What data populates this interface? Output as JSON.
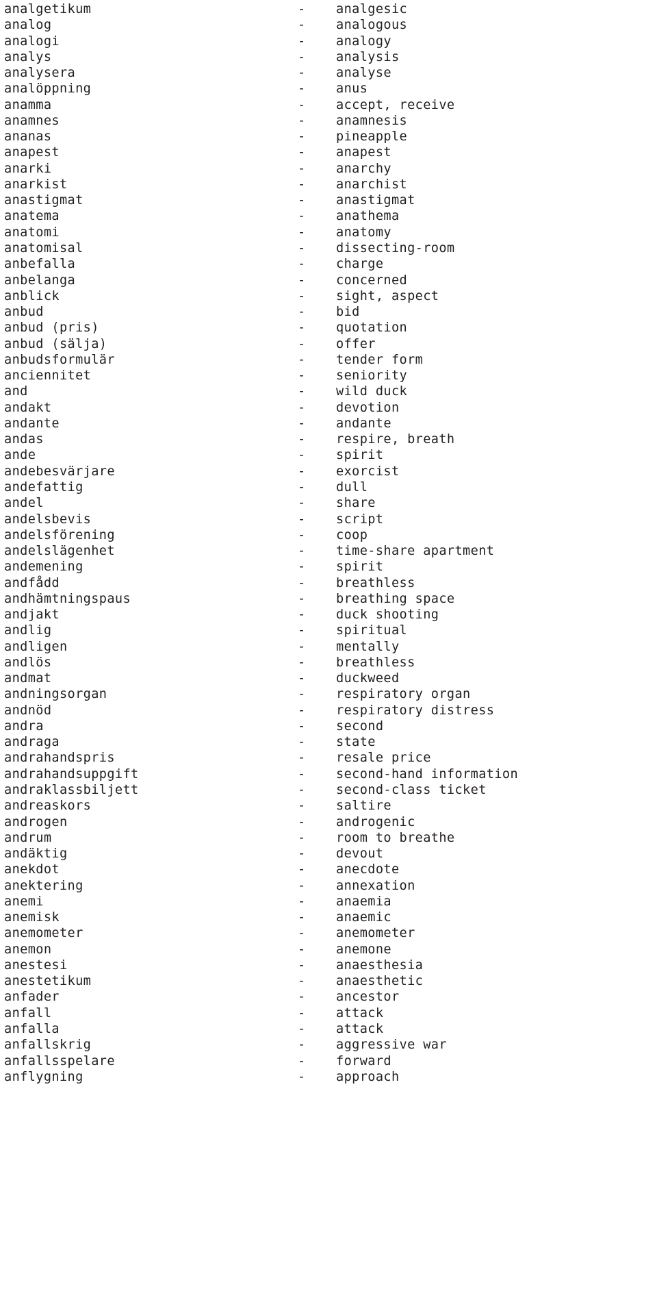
{
  "page": {
    "kind": "bilingual-dictionary-wordlist",
    "source_language": "Swedish",
    "target_language": "English",
    "separator": "-",
    "text_color": "#231f20",
    "background_color": "#ffffff"
  },
  "entries": [
    {
      "swedish": "analgetikum",
      "dash": "-",
      "english": "analgesic"
    },
    {
      "swedish": "analog",
      "dash": "-",
      "english": "analogous"
    },
    {
      "swedish": "analogi",
      "dash": "-",
      "english": "analogy"
    },
    {
      "swedish": "analys",
      "dash": "-",
      "english": "analysis"
    },
    {
      "swedish": "analysera",
      "dash": "-",
      "english": "analyse"
    },
    {
      "swedish": "analöppning",
      "dash": "-",
      "english": "anus"
    },
    {
      "swedish": "anamma",
      "dash": "-",
      "english": "accept, receive"
    },
    {
      "swedish": "anamnes",
      "dash": "-",
      "english": "anamnesis"
    },
    {
      "swedish": "ananas",
      "dash": "-",
      "english": "pineapple"
    },
    {
      "swedish": "anapest",
      "dash": "-",
      "english": "anapest"
    },
    {
      "swedish": "anarki",
      "dash": "-",
      "english": "anarchy"
    },
    {
      "swedish": "anarkist",
      "dash": "-",
      "english": "anarchist"
    },
    {
      "swedish": "anastigmat",
      "dash": "-",
      "english": "anastigmat"
    },
    {
      "swedish": "anatema",
      "dash": "-",
      "english": "anathema"
    },
    {
      "swedish": "anatomi",
      "dash": "-",
      "english": "anatomy"
    },
    {
      "swedish": "anatomisal",
      "dash": "-",
      "english": "dissecting-room"
    },
    {
      "swedish": "anbefalla",
      "dash": "-",
      "english": "charge"
    },
    {
      "swedish": "anbelanga",
      "dash": "-",
      "english": "concerned"
    },
    {
      "swedish": "anblick",
      "dash": "-",
      "english": "sight, aspect"
    },
    {
      "swedish": "anbud",
      "dash": "-",
      "english": "bid"
    },
    {
      "swedish": "anbud (pris)",
      "dash": "-",
      "english": "quotation"
    },
    {
      "swedish": "anbud (sälja)",
      "dash": "-",
      "english": "offer"
    },
    {
      "swedish": "anbudsformulär",
      "dash": "-",
      "english": "tender form"
    },
    {
      "swedish": "anciennitet",
      "dash": "-",
      "english": "seniority"
    },
    {
      "swedish": "and",
      "dash": "-",
      "english": "wild duck"
    },
    {
      "swedish": "andakt",
      "dash": "-",
      "english": "devotion"
    },
    {
      "swedish": "andante",
      "dash": "-",
      "english": "andante"
    },
    {
      "swedish": "andas",
      "dash": "-",
      "english": "respire, breath"
    },
    {
      "swedish": "ande",
      "dash": "-",
      "english": "spirit"
    },
    {
      "swedish": "andebesvärjare",
      "dash": "-",
      "english": "exorcist"
    },
    {
      "swedish": "andefattig",
      "dash": "-",
      "english": "dull"
    },
    {
      "swedish": "andel",
      "dash": "-",
      "english": "share"
    },
    {
      "swedish": "andelsbevis",
      "dash": "-",
      "english": "script"
    },
    {
      "swedish": "andelsförening",
      "dash": "-",
      "english": "coop"
    },
    {
      "swedish": "andelslägenhet",
      "dash": "-",
      "english": "time-share apartment"
    },
    {
      "swedish": "andemening",
      "dash": "-",
      "english": "spirit"
    },
    {
      "swedish": "andfådd",
      "dash": "-",
      "english": "breathless"
    },
    {
      "swedish": "andhämtningspaus",
      "dash": "-",
      "english": "breathing space"
    },
    {
      "swedish": "andjakt",
      "dash": "-",
      "english": "duck shooting"
    },
    {
      "swedish": "andlig",
      "dash": "-",
      "english": "spiritual"
    },
    {
      "swedish": "andligen",
      "dash": "-",
      "english": "mentally"
    },
    {
      "swedish": "andlös",
      "dash": "-",
      "english": "breathless"
    },
    {
      "swedish": "andmat",
      "dash": "-",
      "english": "duckweed"
    },
    {
      "swedish": "andningsorgan",
      "dash": "-",
      "english": "respiratory organ"
    },
    {
      "swedish": "andnöd",
      "dash": "-",
      "english": "respiratory distress"
    },
    {
      "swedish": "andra",
      "dash": "-",
      "english": "second"
    },
    {
      "swedish": "andraga",
      "dash": "-",
      "english": "state"
    },
    {
      "swedish": "andrahandspris",
      "dash": "-",
      "english": "resale price"
    },
    {
      "swedish": "andrahandsuppgift",
      "dash": "-",
      "english": "second-hand information"
    },
    {
      "swedish": "andraklassbiljett",
      "dash": "-",
      "english": "second-class ticket"
    },
    {
      "swedish": "andreaskors",
      "dash": "-",
      "english": "saltire"
    },
    {
      "swedish": "androgen",
      "dash": "-",
      "english": "androgenic"
    },
    {
      "swedish": "andrum",
      "dash": "-",
      "english": "room to breathe"
    },
    {
      "swedish": "andäktig",
      "dash": "-",
      "english": "devout"
    },
    {
      "swedish": "anekdot",
      "dash": "-",
      "english": "anecdote"
    },
    {
      "swedish": "anektering",
      "dash": "-",
      "english": "annexation"
    },
    {
      "swedish": "anemi",
      "dash": "-",
      "english": "anaemia"
    },
    {
      "swedish": "anemisk",
      "dash": "-",
      "english": "anaemic"
    },
    {
      "swedish": "anemometer",
      "dash": "-",
      "english": "anemometer"
    },
    {
      "swedish": "anemon",
      "dash": "-",
      "english": "anemone"
    },
    {
      "swedish": "anestesi",
      "dash": "-",
      "english": "anaesthesia"
    },
    {
      "swedish": "anestetikum",
      "dash": "-",
      "english": "anaesthetic"
    },
    {
      "swedish": "anfader",
      "dash": "-",
      "english": "ancestor"
    },
    {
      "swedish": "anfall",
      "dash": "-",
      "english": "attack"
    },
    {
      "swedish": "anfalla",
      "dash": "-",
      "english": "attack"
    },
    {
      "swedish": "anfallskrig",
      "dash": "-",
      "english": "aggressive war"
    },
    {
      "swedish": "anfallsspelare",
      "dash": "-",
      "english": "forward"
    },
    {
      "swedish": "anflygning",
      "dash": "-",
      "english": "approach"
    }
  ]
}
